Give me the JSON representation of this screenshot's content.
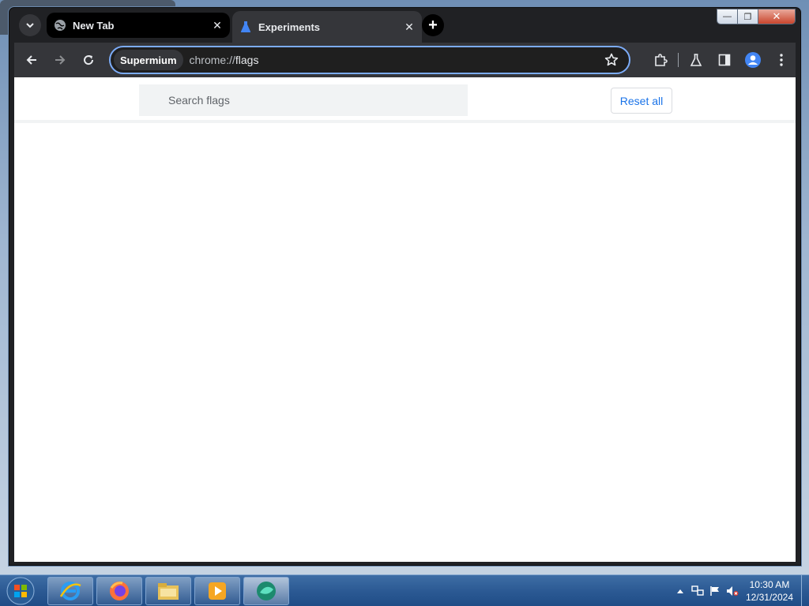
{
  "browser": {
    "tabs": [
      {
        "title": "New Tab",
        "icon": "globe-icon",
        "active": false
      },
      {
        "title": "Experiments",
        "icon": "flask-icon",
        "active": true
      }
    ],
    "close_glyph": "✕",
    "new_tab_glyph": "+",
    "caption": {
      "minimize": "—",
      "maximize": "❐",
      "close": "✕"
    },
    "omnibox": {
      "chip": "Supermium",
      "url_scheme": "chrome://",
      "url_path": "flags"
    }
  },
  "page": {
    "search_placeholder": "Search flags",
    "reset_label": "Reset all"
  },
  "taskbar": {
    "apps": [
      "internet-explorer-icon",
      "firefox-icon",
      "file-explorer-icon",
      "media-player-icon",
      "supermium-icon"
    ],
    "clock_time": "10:30 AM",
    "clock_date": "12/31/2024"
  },
  "colors": {
    "accent": "#1a73e8",
    "omnibox_focus": "#7cacf8",
    "toolbar": "#35363a"
  }
}
